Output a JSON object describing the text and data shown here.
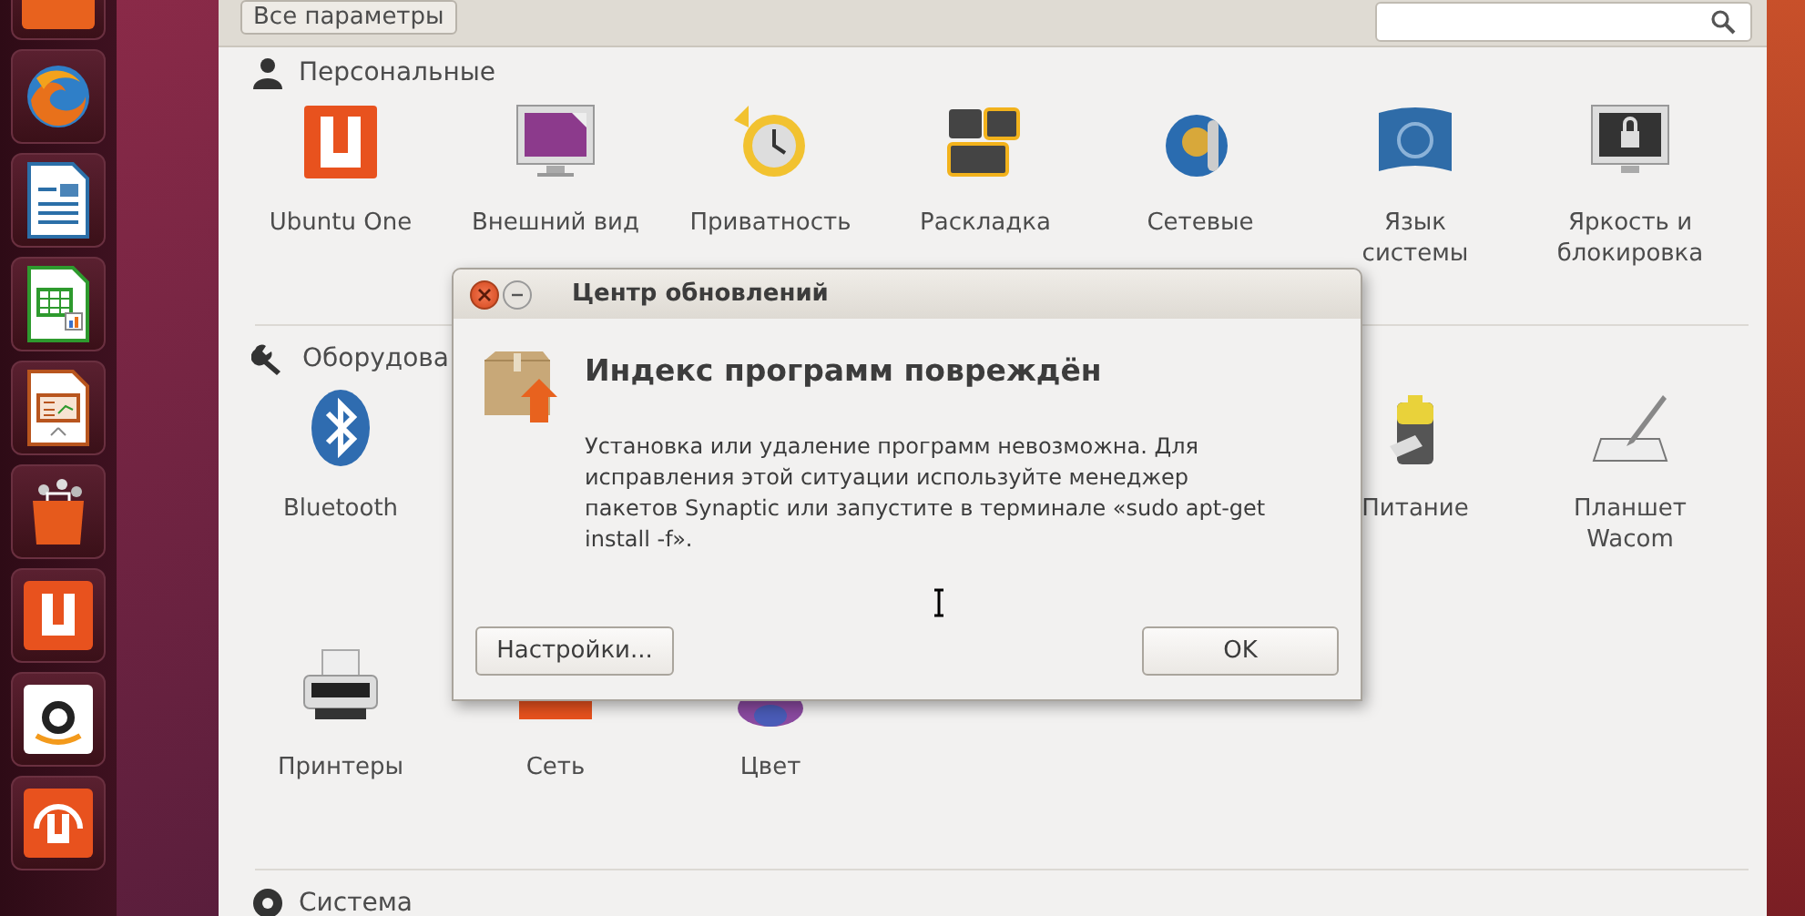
{
  "settings_window": {
    "all_settings_button": "Все параметры",
    "sections": [
      {
        "title": "Персональные",
        "items": [
          {
            "label": "Ubuntu One"
          },
          {
            "label": "Внешний вид"
          },
          {
            "label": "Приватность"
          },
          {
            "label": "Раскладка"
          },
          {
            "label": "Сетевые"
          },
          {
            "label": "Язык\nсистемы"
          },
          {
            "label": "Яркость и\nблокировка"
          }
        ]
      },
      {
        "title": "Оборудова",
        "items": [
          {
            "label": "Bluetooth"
          },
          {
            "label": "Питание"
          },
          {
            "label": "Планшет\nWacom"
          },
          {
            "label": "Принтеры"
          },
          {
            "label": "Сеть"
          },
          {
            "label": "Цвет"
          }
        ]
      },
      {
        "title": "Система"
      }
    ]
  },
  "dialog": {
    "title": "Центр обновлений",
    "heading": "Индекс программ повреждён",
    "message": "Установка или удаление программ невозможна. Для\nисправления этой ситуации используйте менеджер\nпакетов Synaptic или запустите в терминале «sudo apt-get\ninstall -f».",
    "buttons": [
      "Настройки...",
      "OK"
    ]
  }
}
